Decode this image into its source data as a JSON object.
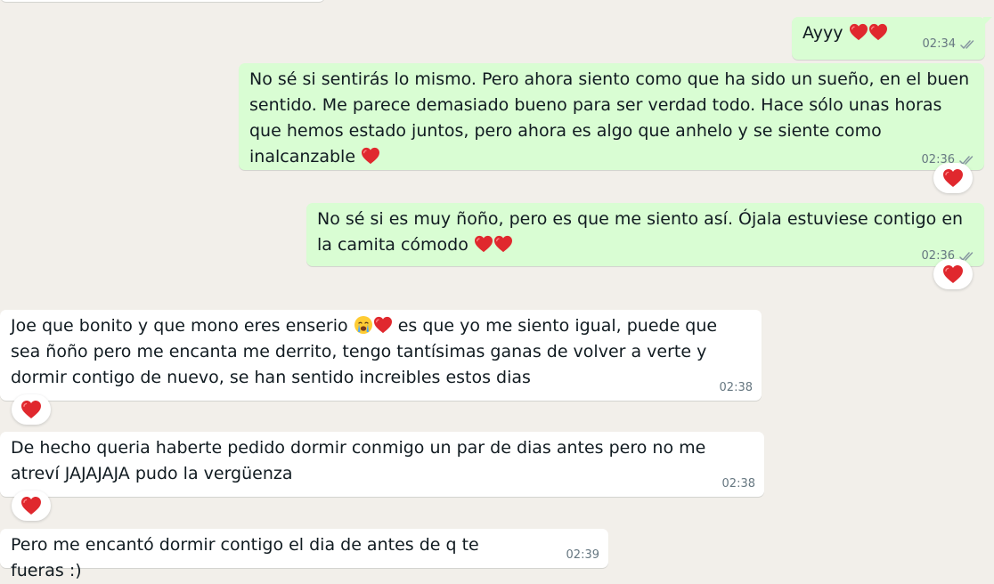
{
  "colors": {
    "background": "#f2efea",
    "outgoing_bubble": "#d9fdd3",
    "incoming_bubble": "#ffffff",
    "meta_text": "#667781",
    "heart": "#e0282e"
  },
  "messages": [
    {
      "direction": "out",
      "text": "Ayyy",
      "emoji": [
        "heart",
        "heart"
      ],
      "time": "02:34",
      "status_icon": "double-check-icon"
    },
    {
      "direction": "out",
      "text": "No sé si sentirás lo mismo. Pero ahora siento como que ha sido un sueño, en el buen sentido. Me parece demasiado bueno para ser verdad todo. Hace sólo unas horas que hemos estado juntos, pero ahora es algo que anhelo y se siente como inalcanzable",
      "emoji": [
        "heart"
      ],
      "time": "02:36",
      "status_icon": "double-check-icon",
      "reaction": "heart"
    },
    {
      "direction": "out",
      "text": "No sé si es muy ñoño, pero es que me siento así. Ójala estuviese contigo en la camita cómodo",
      "emoji": [
        "heart",
        "heart"
      ],
      "time": "02:36",
      "status_icon": "double-check-icon",
      "reaction": "heart"
    },
    {
      "direction": "in",
      "text_before": "Joe que bonito y que mono eres enserio",
      "emoji": [
        "crying-face",
        "heart"
      ],
      "text_after": "es que yo me siento igual, puede que sea ñoño pero me encanta me derrito, tengo tantísimas ganas de volver a verte y dormir contigo de nuevo, se han sentido increibles estos dias",
      "time": "02:38",
      "reaction": "heart"
    },
    {
      "direction": "in",
      "text": "De hecho queria haberte pedido dormir conmigo un par de dias antes pero no me atreví JAJAJAJA pudo la vergüenza",
      "time": "02:38",
      "reaction": "heart"
    },
    {
      "direction": "in",
      "text": "Pero me encantó dormir contigo el dia de antes de q te fueras :)",
      "time": "02:39"
    }
  ]
}
